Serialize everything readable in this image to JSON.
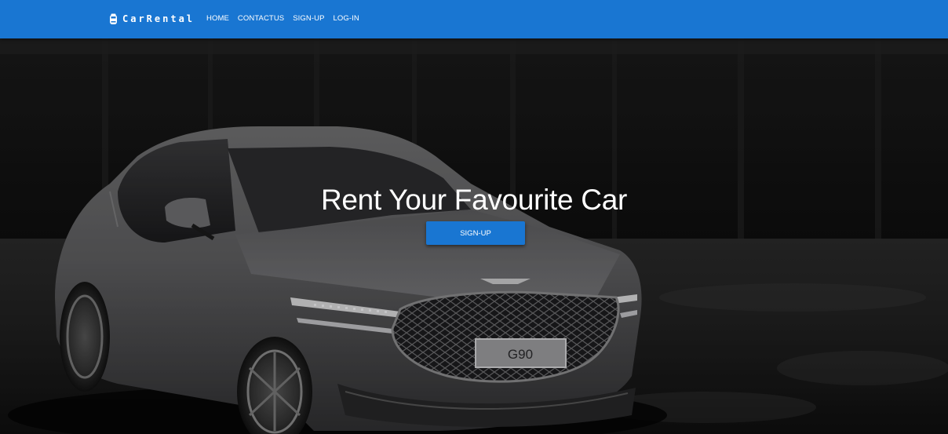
{
  "navbar": {
    "brand": "CarRental",
    "brand_icon": "car-icon",
    "links": [
      "HOME",
      "CONTACTUS",
      "SIGN-UP",
      "LOG-IN"
    ],
    "color": "#1976d2"
  },
  "hero": {
    "title": "Rent Your Favourite Car",
    "button_label": "SIGN-UP",
    "plate_text": "G90"
  }
}
